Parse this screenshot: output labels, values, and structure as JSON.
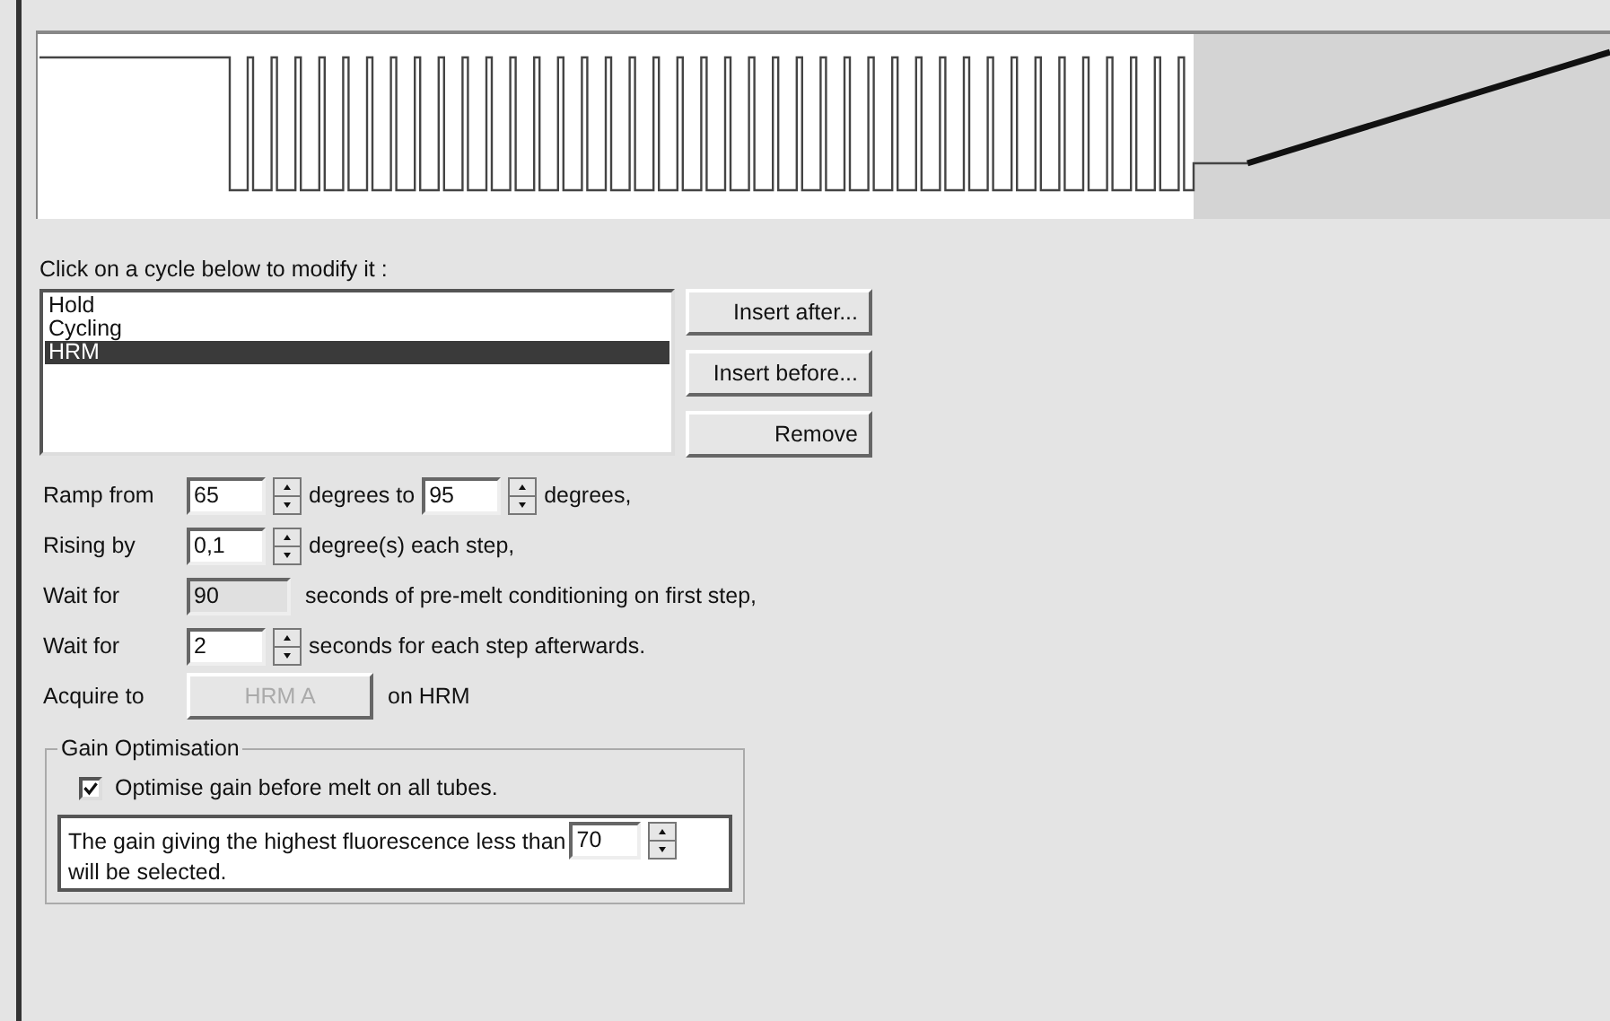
{
  "cycle_list": {
    "caption": "Click on a cycle below to modify it :",
    "items": [
      {
        "label": "Hold",
        "selected": false
      },
      {
        "label": "Cycling",
        "selected": false
      },
      {
        "label": "HRM",
        "selected": true
      }
    ]
  },
  "buttons": [
    "Insert after...",
    "Insert before...",
    "Remove"
  ],
  "settings": [
    {
      "label": "Ramp from",
      "parts": [
        {
          "kind": "spin",
          "value": "65"
        },
        {
          "kind": "text",
          "text": "degrees to"
        },
        {
          "kind": "spin",
          "value": "95"
        },
        {
          "kind": "text",
          "text": "degrees,"
        }
      ]
    },
    {
      "label": "Rising by",
      "parts": [
        {
          "kind": "spin",
          "value": "0,1"
        },
        {
          "kind": "text",
          "text": "degree(s) each step,"
        }
      ]
    },
    {
      "label": "Wait for",
      "parts": [
        {
          "kind": "field",
          "value": "90",
          "disabled": true
        },
        {
          "kind": "text",
          "text": "seconds of pre-melt conditioning on first step,"
        }
      ]
    },
    {
      "label": "Wait for",
      "parts": [
        {
          "kind": "spin",
          "value": "2"
        },
        {
          "kind": "text",
          "text": "seconds for each step afterwards."
        }
      ]
    },
    {
      "label": "Acquire to",
      "parts": [
        {
          "kind": "button",
          "label": "HRM A",
          "disabled": true
        },
        {
          "kind": "text",
          "text": "on HRM"
        }
      ]
    }
  ],
  "gain": {
    "title": "Gain Optimisation",
    "checkbox": {
      "label": "Optimise gain before melt on all tubes.",
      "checked": true
    },
    "threshold": {
      "text_before": "The gain giving the highest fluorescence less than",
      "value": "70",
      "text_after": "will be selected."
    }
  }
}
